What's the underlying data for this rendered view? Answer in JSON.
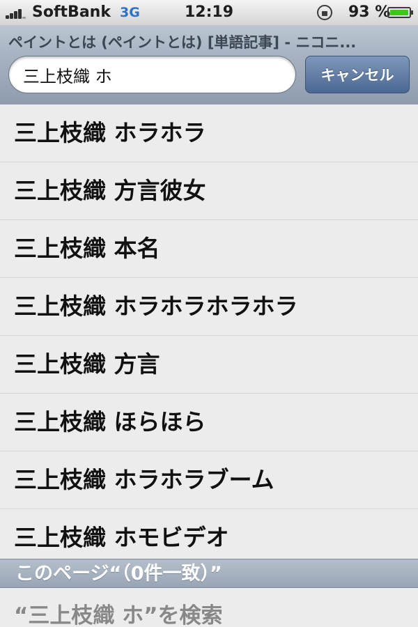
{
  "status_bar": {
    "carrier": "SoftBank",
    "network": "3G",
    "time": "12:19",
    "battery_percent": "93 %",
    "icons": [
      "signal-icon",
      "rotation-lock-icon",
      "battery-icon"
    ]
  },
  "page_title": "ペイントとは (ペイントとは) [単語記事] - ニコニ...",
  "search": {
    "value": "三上枝織 ホ",
    "cancel_label": "キャンセル"
  },
  "suggestions": [
    "三上枝織 ホラホラ",
    "三上枝織 方言彼女",
    "三上枝織 本名",
    "三上枝織 ホラホラホラホラ",
    "三上枝織 方言",
    "三上枝織 ほらほら",
    "三上枝織 ホラホラブーム",
    "三上枝織 ホモビデオ"
  ],
  "find_on_page_header": "このページ“（0件一致）”",
  "search_web_label": "“三上枝織 ホ”を検索",
  "colors": {
    "accent_button": "#5a77a1",
    "battery": "#43c31f",
    "network": "#2e72c7"
  }
}
